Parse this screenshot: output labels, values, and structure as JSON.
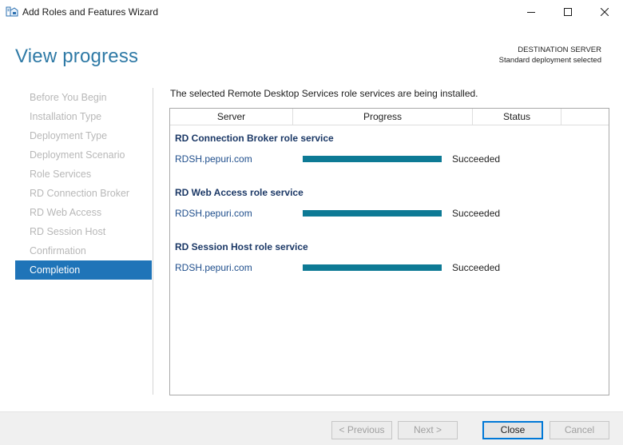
{
  "window": {
    "title": "Add Roles and Features Wizard",
    "icon": "server-manager-icon",
    "controls": [
      "minimize-icon",
      "maximize-icon",
      "close-icon"
    ]
  },
  "header": {
    "title": "View progress",
    "destination_label": "DESTINATION SERVER",
    "destination_value": "Standard deployment selected"
  },
  "sidebar": {
    "items": [
      {
        "label": "Before You Begin",
        "active": false
      },
      {
        "label": "Installation Type",
        "active": false
      },
      {
        "label": "Deployment Type",
        "active": false
      },
      {
        "label": "Deployment Scenario",
        "active": false
      },
      {
        "label": "Role Services",
        "active": false
      },
      {
        "label": "RD Connection Broker",
        "active": false
      },
      {
        "label": "RD Web Access",
        "active": false
      },
      {
        "label": "RD Session Host",
        "active": false
      },
      {
        "label": "Confirmation",
        "active": false
      },
      {
        "label": "Completion",
        "active": true
      }
    ]
  },
  "main": {
    "intro": "The selected Remote Desktop Services role services are being installed.",
    "columns": [
      "Server",
      "Progress",
      "Status"
    ],
    "groups": [
      {
        "title": "RD Connection Broker role service",
        "rows": [
          {
            "server": "RDSH.pepuri.com",
            "progress": 1.0,
            "status": "Succeeded"
          }
        ]
      },
      {
        "title": "RD Web Access role service",
        "rows": [
          {
            "server": "RDSH.pepuri.com",
            "progress": 1.0,
            "status": "Succeeded"
          }
        ]
      },
      {
        "title": "RD Session Host role service",
        "rows": [
          {
            "server": "RDSH.pepuri.com",
            "progress": 1.0,
            "status": "Succeeded"
          }
        ]
      }
    ]
  },
  "footer": {
    "previous_label": "< Previous",
    "next_label": "Next >",
    "close_label": "Close",
    "cancel_label": "Cancel",
    "previous_enabled": false,
    "next_enabled": false,
    "cancel_enabled": false
  },
  "colors": {
    "accent": "#1f74b8",
    "title": "#2f7aa6",
    "progress_fill": "#0d7a95",
    "group_title": "#1b3866"
  }
}
